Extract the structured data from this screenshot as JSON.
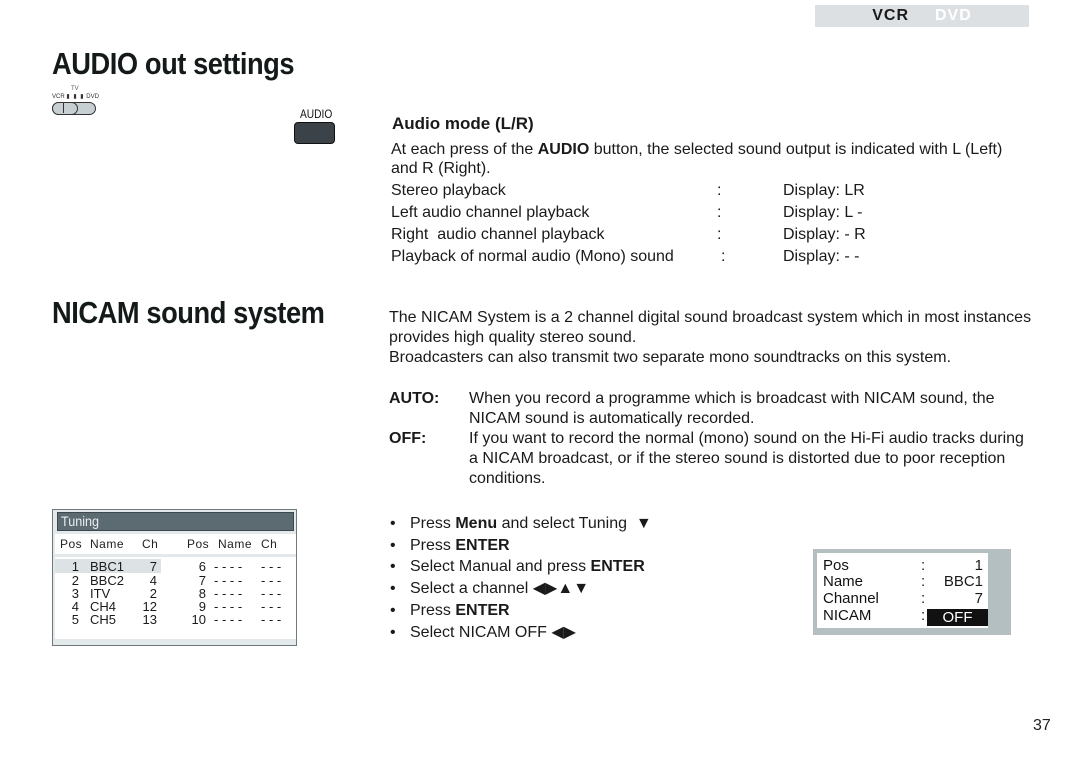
{
  "header_tabs": {
    "active": "VCR",
    "inactive": "DVD"
  },
  "sections": {
    "audio_title": "AUDIO out settings",
    "nicam_title": "NICAM sound system"
  },
  "switch_graphic": {
    "top_label": "TV",
    "left_label": "VCR",
    "right_label": "DVD",
    "dots": "▮ ▮ ▮"
  },
  "remote_button": {
    "label": "AUDIO"
  },
  "audio_mode": {
    "heading": "Audio mode (L/R)",
    "intro_pre": "At each press of the ",
    "intro_bold": "AUDIO",
    "intro_post": " button, the selected sound output is indicated with L (Left) and R (Right).",
    "rows": [
      {
        "mode": "Stereo playback",
        "sep": ":",
        "display": "Display: LR"
      },
      {
        "mode": "Left audio channel playback",
        "sep": ":",
        "display": "Display: L -"
      },
      {
        "mode": "Right  audio channel playback",
        "sep": ":",
        "display": "Display: - R"
      },
      {
        "mode": "Playback of normal audio (Mono) sound",
        "sep": ":",
        "display": "Display: - -"
      }
    ]
  },
  "nicam": {
    "para1": "The NICAM System is a 2 channel digital sound broadcast system which in most instances provides high quality stereo sound.",
    "para2": "Broadcasters can also transmit two separate mono soundtracks on this system.",
    "definitions": [
      {
        "term": "AUTO:",
        "text": "When you record a programme which is broadcast with NICAM sound, the NICAM sound is automatically recorded."
      },
      {
        "term": "OFF:",
        "text": "If you want to record the normal (mono) sound on the Hi-Fi audio tracks during a NICAM broadcast, or if the stereo sound is distorted due to poor reception conditions."
      }
    ],
    "steps": [
      {
        "pre": "Press ",
        "bold": "Menu",
        "post": " and select Tuning  ▼"
      },
      {
        "pre": "Press ",
        "bold": "ENTER",
        "post": ""
      },
      {
        "pre": "Select Manual and press ",
        "bold": "ENTER",
        "post": ""
      },
      {
        "pre": "Select a channel ◀▶▲▼",
        "bold": "",
        "post": ""
      },
      {
        "pre": "Press ",
        "bold": "ENTER",
        "post": ""
      },
      {
        "pre": "Select NICAM OFF ◀▶",
        "bold": "",
        "post": ""
      }
    ],
    "bullet": "•"
  },
  "tuning_panel": {
    "title": "Tuning",
    "headers": [
      "Pos",
      "Name",
      "Ch",
      "Pos",
      "Name",
      "Ch"
    ],
    "left_rows": [
      {
        "pos": "1",
        "name": "BBC1",
        "ch": "7"
      },
      {
        "pos": "2",
        "name": "BBC2",
        "ch": "4"
      },
      {
        "pos": "3",
        "name": "ITV",
        "ch": "2"
      },
      {
        "pos": "4",
        "name": "CH4",
        "ch": "12"
      },
      {
        "pos": "5",
        "name": "CH5",
        "ch": "13"
      }
    ],
    "right_rows": [
      {
        "pos": "6",
        "name": "- - - -",
        "ch": "- - -"
      },
      {
        "pos": "7",
        "name": "- - - -",
        "ch": "- - -"
      },
      {
        "pos": "8",
        "name": "- - - -",
        "ch": "- - -"
      },
      {
        "pos": "9",
        "name": "- - - -",
        "ch": "- - -"
      },
      {
        "pos": "10",
        "name": "- - - -",
        "ch": "- - -"
      }
    ],
    "selected_pos": "1"
  },
  "osd_panel": {
    "rows": [
      {
        "label": "Pos",
        "sep": ":",
        "value": "1"
      },
      {
        "label": "Name",
        "sep": ":",
        "value": "BBC1"
      },
      {
        "label": "Channel",
        "sep": ":",
        "value": "7"
      },
      {
        "label": "NICAM",
        "sep": ":",
        "value": "OFF"
      }
    ]
  },
  "page_number": "37",
  "colors": {
    "tab_bg": "#dde0e2",
    "tuning_header": "#5c6a71",
    "osd_frame": "#b4bfc1",
    "remote_button": "#3b4248",
    "highlight": "#111111"
  }
}
